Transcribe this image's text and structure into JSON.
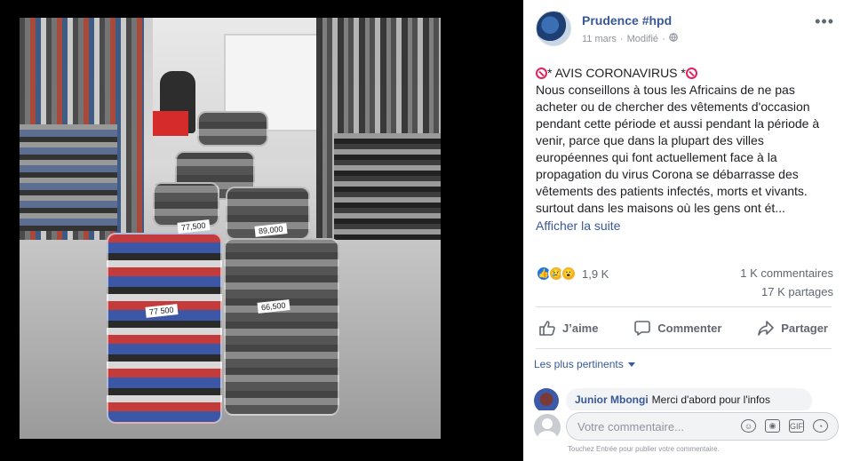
{
  "post": {
    "author": "Prudence #hpd",
    "date": "11 mars",
    "edited": "Modifié",
    "separator": "·",
    "more_label": "•••",
    "title_text": "* AVIS CORONAVIRUS *",
    "body_lines": [
      "Nous conseillons à tous les Africains de ne pas",
      "acheter ou de chercher des vêtements d'occasion",
      "pendant cette période et aussi pendant la période à",
      "venir, parce que dans la plupart des villes",
      "européennes qui font actuellement face à la",
      "propagation du virus Corona se débarrasse des",
      "vêtements des patients infectés, morts et vivants.",
      "surtout dans les maisons où les gens ont ét..."
    ],
    "see_more": "Afficher la suite"
  },
  "photo": {
    "tags": [
      "77 500",
      "66,500",
      "77,500",
      "89,000"
    ]
  },
  "stats": {
    "reactions_count": "1,9 K",
    "comments": "1 K commentaires",
    "shares": "17 K partages",
    "reaction_icons": [
      "like-icon",
      "sad-icon",
      "wow-icon"
    ]
  },
  "actions": {
    "like": "J’aime",
    "comment": "Commenter",
    "share": "Partager"
  },
  "comments": {
    "filter": "Les plus pertinents",
    "first": {
      "author": "Junior Mbongi",
      "text": "Merci d'abord pour l'infos"
    }
  },
  "composer": {
    "placeholder": "Votre commentaire...",
    "hint": "Touchez Entrée pour publier votre commentaire.",
    "gif_label": "GIF"
  },
  "colors": {
    "link": "#385898",
    "like_blue": "#1877f2",
    "no_entry_red": "#e0245e"
  }
}
